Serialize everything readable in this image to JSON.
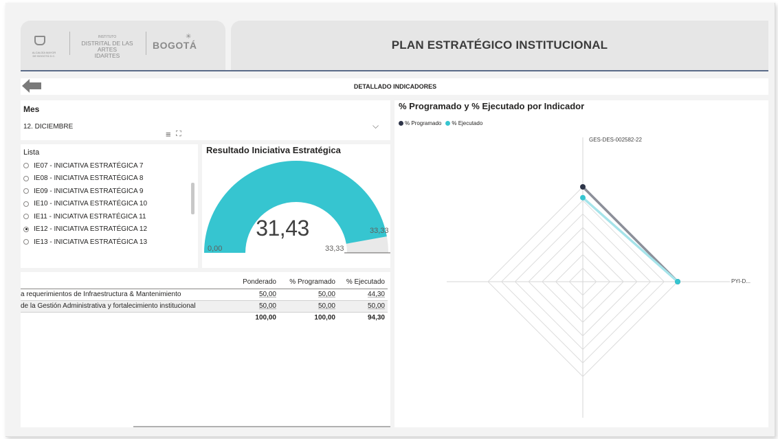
{
  "header": {
    "logo_institute_small": "INSTITUTO",
    "logo_institute": "DISTRITAL DE LAS ARTES",
    "logo_acronym": "IDARTES",
    "logo_city": "BOGOTÁ",
    "page_title": "PLAN ESTRATÉGICO INSTITUCIONAL"
  },
  "nav": {
    "title": "DETALLADO INDICADORES"
  },
  "mes_slicer": {
    "label": "Mes",
    "selected": "12. DICIEMBRE"
  },
  "lista_slicer": {
    "label": "Lista",
    "items": [
      {
        "label": "IE07 - INICIATIVA ESTRATÉGICA 7",
        "selected": false
      },
      {
        "label": "IE08 - INICIATIVA ESTRATÉGICA 8",
        "selected": false
      },
      {
        "label": "IE09 - INICIATIVA ESTRATÉGICA 9",
        "selected": false
      },
      {
        "label": "IE10 - INICIATIVA ESTRATÉGICA 10",
        "selected": false
      },
      {
        "label": "IE11 - INICIATIVA ESTRATÉGICA 11",
        "selected": false
      },
      {
        "label": "IE12 - INICIATIVA ESTRATÉGICA 12",
        "selected": true
      },
      {
        "label": "IE13 - INICIATIVA ESTRATÉGICA 13",
        "selected": false
      }
    ]
  },
  "gauge": {
    "title": "Resultado Iniciativa Estratégica",
    "value": 31.43,
    "value_label": "31,43",
    "min_label": "0,00",
    "max_label": "33,33",
    "target_label": "33,33",
    "min": 0,
    "max": 33.33,
    "target": 33.33,
    "fill_color": "#36c5d0",
    "track_color": "#e9e9e9"
  },
  "table": {
    "headers": [
      "",
      "Ponderado",
      "% Programado",
      "% Ejecutado"
    ],
    "rows": [
      [
        "a requerimientos de Infraestructura & Mantenimiento",
        "50,00",
        "50,00",
        "44,30"
      ],
      [
        "de la Gestión Administrativa y fortalecimiento institucional",
        "50,00",
        "50,00",
        "50,00"
      ]
    ],
    "total": [
      "",
      "100,00",
      "100,00",
      "94,30"
    ]
  },
  "radar": {
    "title": "% Programado y % Ejecutado por Indicador",
    "legend": [
      {
        "name": "% Programado",
        "color": "#2d3448"
      },
      {
        "name": "% Ejecutado",
        "color": "#36c5d0"
      }
    ],
    "axis_labels": [
      "GES-DES-002582-22",
      "PYI-D..."
    ]
  },
  "chart_data": {
    "type": "radar",
    "title": "% Programado y % Ejecutado por Indicador",
    "categories": [
      "GES-DES-002582-22",
      "PYI-D..."
    ],
    "series": [
      {
        "name": "% Programado",
        "values": [
          100,
          100
        ],
        "color": "#2d3448"
      },
      {
        "name": "% Ejecutado",
        "values": [
          88.6,
          100
        ],
        "color": "#36c5d0"
      }
    ],
    "rlim": [
      0,
      100
    ],
    "legend_position": "top-left"
  }
}
